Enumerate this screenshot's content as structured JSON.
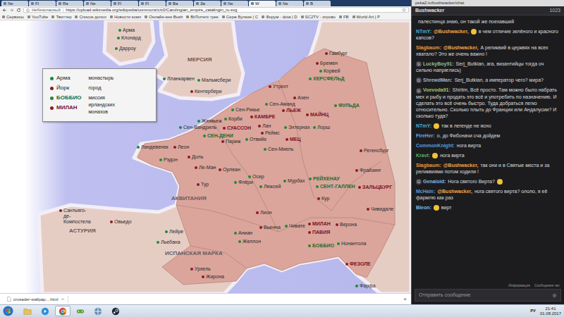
{
  "browser": {
    "tabs": [
      {
        "label": "Ne",
        "selected": false
      },
      {
        "label": "Fl",
        "selected": false
      },
      {
        "label": "Ra",
        "selected": false
      },
      {
        "label": "Ne",
        "selected": false
      },
      {
        "label": "Fl",
        "selected": false
      },
      {
        "label": "Fl",
        "selected": false
      },
      {
        "label": "Ba",
        "selected": false
      },
      {
        "label": "За",
        "selected": false
      },
      {
        "label": "Ne",
        "selected": false
      },
      {
        "label": "W",
        "selected": true
      },
      {
        "label": "Ne",
        "selected": false
      },
      {
        "label": "В",
        "selected": false
      }
    ],
    "address": {
      "security": "Небезопасный",
      "separator": "|",
      "url": "https://upload.wikimedia.org/wikipedia/commons/c/c0/Carolingian_empire_catalingin_ru.svg"
    },
    "bookmarks": [
      "Сервисы",
      "YouTube",
      "Твиттер",
      "Список допол",
      "Новости комп",
      "Онлайн-кни Bush",
      "BitTorrent трек",
      "Серж Булкин | С",
      "Форум - dota | D",
      "SC2TV - игрово",
      "FB",
      "World Art | Р"
    ],
    "download_bar": {
      "items": [
        {
          "name": "crusader-wallpap....html"
        }
      ],
      "close": "×"
    }
  },
  "map": {
    "legend": {
      "markers": [
        {
          "label": "Арма",
          "kind": "monastery",
          "major": false
        },
        {
          "label": "Йорк",
          "kind": "city",
          "major": false
        },
        {
          "label": "БОББИО",
          "kind": "monastery",
          "major": true
        },
        {
          "label": "МИЛАН",
          "kind": "city",
          "major": true
        }
      ],
      "descriptions": [
        "монастырь",
        "город",
        "миссия ирландских монахов"
      ]
    },
    "pins": [
      {
        "label": "Арма",
        "kind": "monastery",
        "major": false
      },
      {
        "label": "Клонард",
        "kind": "monastery",
        "major": false
      },
      {
        "label": "Дарроу",
        "kind": "monastery",
        "major": false
      },
      {
        "label": "МЕРСИЯ",
        "kind": "region",
        "major": true
      },
      {
        "label": "Лланкарвен",
        "kind": "monastery",
        "major": false
      },
      {
        "label": "Мальмсбери",
        "kind": "monastery",
        "major": false
      },
      {
        "label": "Кентербери",
        "kind": "city",
        "major": false
      },
      {
        "label": "Гамбург",
        "kind": "city",
        "major": false
      },
      {
        "label": "Бремен",
        "kind": "city",
        "major": false
      },
      {
        "label": "Корвей",
        "kind": "monastery",
        "major": false
      },
      {
        "label": "ХЕРСФЕЛЬД",
        "kind": "monastery",
        "major": true
      },
      {
        "label": "Утрехт",
        "kind": "city",
        "major": false
      },
      {
        "label": "Ахен",
        "kind": "city",
        "major": false
      },
      {
        "label": "ФУЛЬДА",
        "kind": "monastery",
        "major": true
      },
      {
        "label": "Сен-Рикье",
        "kind": "monastery",
        "major": false
      },
      {
        "label": "Сен-Аманд",
        "kind": "monastery",
        "major": false
      },
      {
        "label": "ЛЬЕЖ",
        "kind": "city",
        "major": true
      },
      {
        "label": "МАЙНЦ",
        "kind": "city",
        "major": true
      },
      {
        "label": "Корби",
        "kind": "monastery",
        "major": false
      },
      {
        "label": "КАМБРЕ",
        "kind": "city",
        "major": true
      },
      {
        "label": "Жюмьеж",
        "kind": "monastery",
        "major": false
      },
      {
        "label": "Лан",
        "kind": "city",
        "major": false
      },
      {
        "label": "Эхтернах",
        "kind": "monastery",
        "major": false
      },
      {
        "label": "Лорш",
        "kind": "monastery",
        "major": false
      },
      {
        "label": "Сен-Вандриль",
        "kind": "monastery",
        "major": false
      },
      {
        "label": "СУАССОН",
        "kind": "city",
        "major": true
      },
      {
        "label": "Реймс",
        "kind": "city",
        "major": false
      },
      {
        "label": "СЕН-ДЕНИ",
        "kind": "monastery",
        "major": true
      },
      {
        "label": "Париж",
        "kind": "city",
        "major": false
      },
      {
        "label": "Отвийе",
        "kind": "monastery",
        "major": false
      },
      {
        "label": "МЕЦ",
        "kind": "city",
        "major": true
      },
      {
        "label": "Сен-Миель",
        "kind": "monastery",
        "major": false
      },
      {
        "label": "Регенсбург",
        "kind": "city",
        "major": false
      },
      {
        "label": "Ландевенек",
        "kind": "monastery",
        "major": false
      },
      {
        "label": "Леон",
        "kind": "city",
        "major": false
      },
      {
        "label": "Доль",
        "kind": "city",
        "major": false
      },
      {
        "label": "Рэдон",
        "kind": "monastery",
        "major": false
      },
      {
        "label": "Фрайзинг",
        "kind": "city",
        "major": false
      },
      {
        "label": "Ле-Ман",
        "kind": "city",
        "major": false
      },
      {
        "label": "Орлеан",
        "kind": "city",
        "major": false
      },
      {
        "label": "Осер",
        "kind": "monastery",
        "major": false
      },
      {
        "label": "Мурбах",
        "kind": "monastery",
        "major": false
      },
      {
        "label": "РЕЙХЕНАУ",
        "kind": "monastery",
        "major": true
      },
      {
        "label": "СЕНТ-ГАЛЛЕН",
        "kind": "monastery",
        "major": true
      },
      {
        "label": "ЗАЛЬЦБУРГ",
        "kind": "city",
        "major": true
      },
      {
        "label": "Тур",
        "kind": "city",
        "major": false
      },
      {
        "label": "Флёри",
        "kind": "monastery",
        "major": false
      },
      {
        "label": "Люксей",
        "kind": "monastery",
        "major": false
      },
      {
        "label": "Кур",
        "kind": "city",
        "major": false
      },
      {
        "label": "Чивидале",
        "kind": "city",
        "major": false
      },
      {
        "label": "АКВИТАНИЯ",
        "kind": "region",
        "major": true
      },
      {
        "label": "Лион",
        "kind": "city",
        "major": false
      },
      {
        "label": "Вьенна",
        "kind": "city",
        "major": false
      },
      {
        "label": "Чивате",
        "kind": "monastery",
        "major": false
      },
      {
        "label": "МИЛАН",
        "kind": "city",
        "major": true
      },
      {
        "label": "Верона",
        "kind": "city",
        "major": false
      },
      {
        "label": "ПАВИЯ",
        "kind": "city",
        "major": true
      },
      {
        "label": "Нонантола",
        "kind": "monastery",
        "major": false
      },
      {
        "label": "БОББИО",
        "kind": "monastery",
        "major": true
      },
      {
        "label": "Сантьяго-де-Компостела",
        "kind": "city",
        "major": false
      },
      {
        "label": "Овьедо",
        "kind": "city",
        "major": false
      },
      {
        "label": "АСТУРИЯ",
        "kind": "region",
        "major": true
      },
      {
        "label": "Лейре",
        "kind": "monastery",
        "major": false
      },
      {
        "label": "Аниан",
        "kind": "monastery",
        "major": false
      },
      {
        "label": "Желлон",
        "kind": "monastery",
        "major": false
      },
      {
        "label": "Льебана",
        "kind": "monastery",
        "major": false
      },
      {
        "label": "ИСПАНСКАЯ МАРКА",
        "kind": "region",
        "major": true
      },
      {
        "label": "Урхель",
        "kind": "city",
        "major": false
      },
      {
        "label": "Жирона",
        "kind": "city",
        "major": false
      },
      {
        "label": "ФЕЗОЛЕ",
        "kind": "city",
        "major": true
      },
      {
        "label": "Фарфа",
        "kind": "monastery",
        "major": false
      }
    ]
  },
  "chat": {
    "popup_url": "peka2.tv/bushwacker/chat",
    "channel": "Bushwacker",
    "viewers": "1023",
    "messages": [
      {
        "parts": [
          {
            "kind": "text",
            "text": "палестинца знаю, он такой же поехавший"
          }
        ]
      },
      {
        "user": "NTmY:",
        "color": "#4fb0c6",
        "parts": [
          {
            "kind": "mention",
            "text": "@Bushwacker,"
          },
          {
            "kind": "emote"
          },
          {
            "kind": "text",
            "text": "в чем отличие зелёного и красного капсов?"
          }
        ]
      },
      {
        "user": "Slagbaum:",
        "color": "#e59a3c",
        "parts": [
          {
            "kind": "mention",
            "text": "@Bushwacker,"
          },
          {
            "kind": "text",
            "text": "А реликвий в церквях на всех хватало? Это же очень важно !"
          }
        ]
      },
      {
        "user": "LuckyBoy91:",
        "badge": "G",
        "color": "#8fbc8f",
        "parts": [
          {
            "kind": "text",
            "text": "Serj_Butkian, ага, византийцы тогда оч сильно напряглись)"
          }
        ]
      },
      {
        "user": "ShrewdMan:",
        "badge": "G",
        "color": "#9fb3d1",
        "parts": [
          {
            "kind": "text",
            "text": "Serj_Butkian, а император чего? мира?"
          }
        ]
      },
      {
        "user": "Voevoda91:",
        "badge": "G",
        "color": "#a5c46a",
        "parts": [
          {
            "kind": "text",
            "text": "Shirlim, Всё просто. Там можно было набрать мех и рыбу и продать это всё и употребить по назначению. И сделать это всё очень быстро. Туда добраться легко относительно. Сколько плыть до Франции или Андалусии? И сколько туда?"
          }
        ]
      },
      {
        "user": "NTmY:",
        "color": "#4fb0c6",
        "parts": [
          {
            "kind": "emote"
          },
          {
            "kind": "text",
            "text": "так в легенде не ясно"
          }
        ]
      },
      {
        "user": "FireHer:",
        "color": "#6fa8dc",
        "parts": [
          {
            "kind": "text",
            "text": "о, до Фибоначи сча дойдем"
          }
        ]
      },
      {
        "user": "CommonKnight:",
        "color": "#5b9bd5",
        "parts": [
          {
            "kind": "text",
            "text": "нога вирта"
          }
        ]
      },
      {
        "user": "Kravt:",
        "color": "#56b35a",
        "parts": [
          {
            "kind": "emote"
          },
          {
            "kind": "text",
            "text": "нога вирта"
          }
        ]
      },
      {
        "user": "Slagbaum:",
        "color": "#e59a3c",
        "parts": [
          {
            "kind": "mention",
            "text": "@Bushwacker,"
          },
          {
            "kind": "text",
            "text": "так они и в Святые места и за реликвиями потом ходили !"
          }
        ]
      },
      {
        "user": "Genaloid:",
        "badge": "G",
        "color": "#7cb9e8",
        "parts": [
          {
            "kind": "text",
            "text": "Нога святого Вирта?"
          },
          {
            "kind": "emote"
          }
        ]
      },
      {
        "user": "McHain:",
        "color": "#5b9bd5",
        "parts": [
          {
            "kind": "mention",
            "text": "@Bushwacker,"
          },
          {
            "kind": "text",
            "text": "нога святого вирта? ололо, я её фармлю как раз"
          }
        ]
      },
      {
        "user": "Bleon:",
        "color": "#7cb9e8",
        "parts": [
          {
            "kind": "emote"
          },
          {
            "kind": "text",
            "text": "вирт"
          }
        ]
      }
    ],
    "footer_links": [
      "Информация",
      "Сообщения чат"
    ],
    "input": {
      "placeholder": "Отправить сообщение"
    }
  },
  "taskbar": {
    "language": "РУ",
    "time": "21:41",
    "date": "01.08.2017"
  }
}
